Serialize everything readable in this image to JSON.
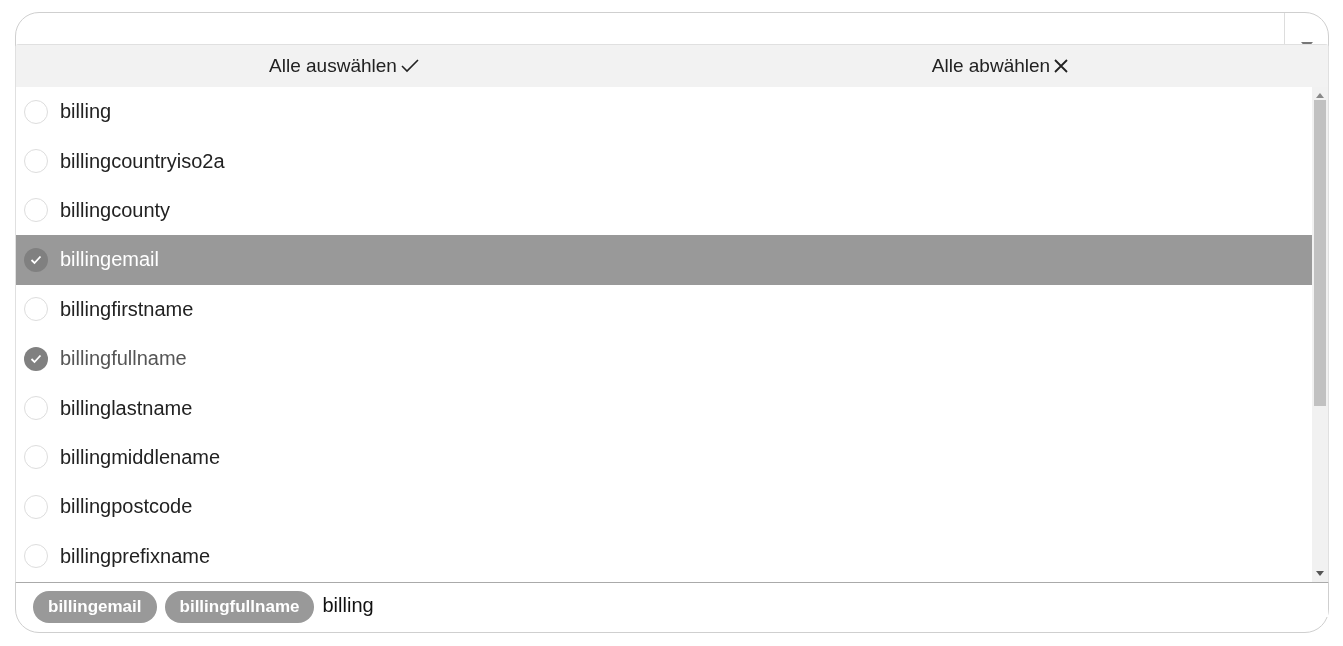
{
  "header": {
    "select_all": "Alle auswählen",
    "deselect_all": "Alle abwählen"
  },
  "options": [
    {
      "label": "billing",
      "selected": false,
      "highlighted": false
    },
    {
      "label": "billingcountryiso2a",
      "selected": false,
      "highlighted": false
    },
    {
      "label": "billingcounty",
      "selected": false,
      "highlighted": false
    },
    {
      "label": "billingemail",
      "selected": true,
      "highlighted": true
    },
    {
      "label": "billingfirstname",
      "selected": false,
      "highlighted": false
    },
    {
      "label": "billingfullname",
      "selected": true,
      "highlighted": false
    },
    {
      "label": "billinglastname",
      "selected": false,
      "highlighted": false
    },
    {
      "label": "billingmiddlename",
      "selected": false,
      "highlighted": false
    },
    {
      "label": "billingpostcode",
      "selected": false,
      "highlighted": false
    },
    {
      "label": "billingprefixname",
      "selected": false,
      "highlighted": false
    }
  ],
  "chips": [
    "billingemail",
    "billingfullname"
  ],
  "search": {
    "value": "billing"
  }
}
